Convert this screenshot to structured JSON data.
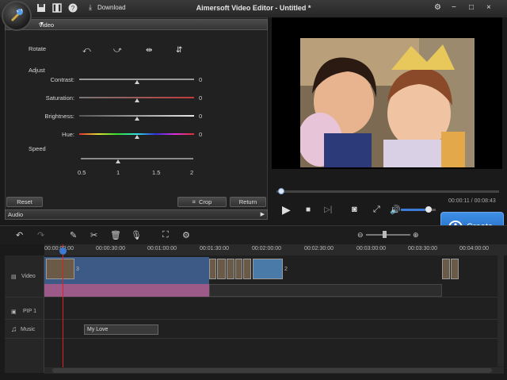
{
  "app": {
    "title": "Aimersoft Video Editor - Untitled *",
    "download_label": "Download"
  },
  "window_controls": [
    "−",
    "□",
    "×"
  ],
  "video_panel": {
    "header": "Video",
    "rotate_label": "Rotate",
    "adjust_label": "Adjust",
    "speed_label": "Speed",
    "adjust": [
      {
        "label": "Contrast:",
        "value": "0",
        "level": 0.5,
        "color": "#9a9a9a"
      },
      {
        "label": "Saturation:",
        "value": "0",
        "level": 0.5,
        "color": "#c23a3a"
      },
      {
        "label": "Brightness:",
        "value": "0",
        "level": 0.5,
        "color": "#bdbdbd"
      },
      {
        "label": "Hue:",
        "value": "0",
        "level": 0.5,
        "color": "rainbow"
      }
    ],
    "speed_ticks": [
      "0.5",
      "1",
      "1.5",
      "2"
    ],
    "speed_value": 1,
    "buttons": {
      "reset": "Reset",
      "crop": "Crop",
      "return": "Return"
    },
    "audio_label": "Audio"
  },
  "player": {
    "time": "00:00:11 / 00:08:43",
    "progress": 0.02,
    "volume": 0.8,
    "create_label": "Create"
  },
  "timeline": {
    "ticks": [
      "00:00:00:00",
      "00:00:30:00",
      "00:01:00:00",
      "00:01:30:00",
      "00:02:00:00",
      "00:02:30:00",
      "00:03:00:00",
      "00:03:30:00",
      "00:04:00:00"
    ],
    "tracks": {
      "video": "Video",
      "pip": "PIP 1",
      "music": "Music"
    },
    "clip_count_1": "3",
    "clip_count_2": "2",
    "music_clip": "My Love"
  },
  "colors": {
    "accent": "#2f7ad8",
    "playhead": "#dd2222",
    "video_clip": "#3d5a86",
    "audio_clip": "#9c5a88"
  }
}
